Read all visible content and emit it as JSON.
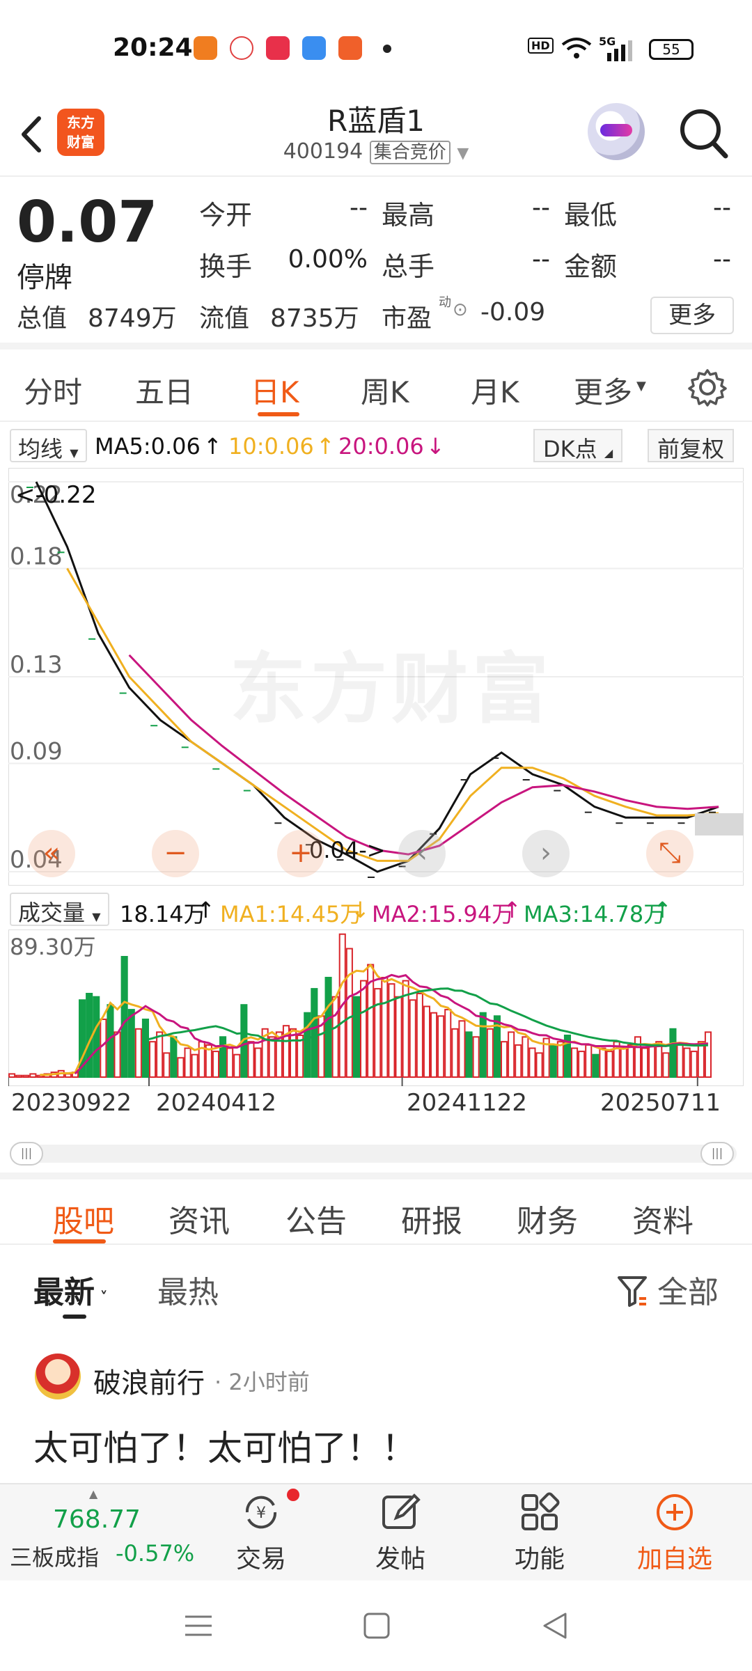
{
  "status": {
    "time": "20:24",
    "battery": "55",
    "network": "5G",
    "hd": "HD"
  },
  "header": {
    "logo_text": "东方财富",
    "title": "R蓝盾1",
    "code": "400194",
    "tag": "集合竞价"
  },
  "quote": {
    "price": "0.07",
    "status": "停牌",
    "fields": [
      {
        "label": "今开",
        "value": "--"
      },
      {
        "label": "最高",
        "value": "--"
      },
      {
        "label": "最低",
        "value": "--"
      },
      {
        "label": "换手",
        "value": "0.00%"
      },
      {
        "label": "总手",
        "value": "--"
      },
      {
        "label": "金额",
        "value": "--"
      }
    ],
    "total_value_label": "总值",
    "total_value": "8749万",
    "float_value_label": "流值",
    "float_value": "8735万",
    "pe_label": "市盈",
    "pe_sup": "动",
    "pe_value": "-0.09",
    "more": "更多"
  },
  "ktabs": [
    "分时",
    "五日",
    "日K",
    "周K",
    "月K",
    "更多"
  ],
  "ma_legend": {
    "select": "均线",
    "ma5": "MA5:0.06",
    "ma10": "10:0.06",
    "ma20": "20:0.06",
    "dk": "DK点",
    "adj": "前复权",
    "colors": {
      "ma5": "#111111",
      "ma10": "#f0b020",
      "ma20": "#c8157e"
    }
  },
  "chart_data": [
    {
      "type": "line",
      "title": "",
      "y_ticks": [
        "0.22",
        "0.18",
        "0.13",
        "0.09",
        "0.04"
      ],
      "ylim": [
        0.04,
        0.22
      ],
      "annotations": [
        "<-0.22",
        "0.04->"
      ],
      "series": [
        {
          "name": "MA5",
          "color": "#111111",
          "values": [
            0.22,
            0.19,
            0.15,
            0.125,
            0.11,
            0.1,
            0.09,
            0.08,
            0.065,
            0.055,
            0.048,
            0.04,
            0.045,
            0.06,
            0.085,
            0.095,
            0.085,
            0.08,
            0.07,
            0.065,
            0.065,
            0.065,
            0.07
          ]
        },
        {
          "name": "MA10",
          "color": "#f0b020",
          "values": [
            null,
            0.18,
            0.155,
            0.13,
            0.115,
            0.1,
            0.09,
            0.08,
            0.07,
            0.06,
            0.05,
            0.045,
            0.045,
            0.055,
            0.075,
            0.088,
            0.088,
            0.083,
            0.075,
            0.07,
            0.066,
            0.066,
            0.067
          ]
        },
        {
          "name": "MA20",
          "color": "#c8157e",
          "values": [
            null,
            null,
            null,
            0.14,
            0.125,
            0.11,
            0.098,
            0.087,
            0.076,
            0.066,
            0.056,
            0.05,
            0.048,
            0.052,
            0.062,
            0.072,
            0.079,
            0.08,
            0.077,
            0.073,
            0.07,
            0.069,
            0.07
          ]
        }
      ]
    },
    {
      "type": "bar",
      "title": "",
      "max_label": "89.30万",
      "ylim": [
        0,
        89.3
      ],
      "x_labels": [
        "20230922",
        "20240412",
        "20241122",
        "20250711"
      ],
      "values": [
        2,
        1,
        1,
        2,
        1,
        2,
        3,
        4,
        2,
        3,
        48,
        52,
        50,
        36,
        45,
        28,
        75,
        42,
        30,
        36,
        22,
        28,
        15,
        25,
        12,
        18,
        14,
        22,
        20,
        16,
        25,
        18,
        14,
        45,
        22,
        18,
        30,
        25,
        28,
        32,
        30,
        26,
        40,
        55,
        38,
        62,
        50,
        89,
        80,
        50,
        60,
        70,
        55,
        62,
        58,
        50,
        60,
        48,
        52,
        44,
        40,
        38,
        42,
        30,
        35,
        28,
        25,
        40,
        30,
        38,
        22,
        28,
        20,
        25,
        18,
        15,
        24,
        20,
        22,
        26,
        18,
        16,
        20,
        14,
        18,
        16,
        22,
        18,
        20,
        25,
        18,
        20,
        22,
        15,
        30,
        20,
        18,
        16,
        22,
        28
      ],
      "colors": [
        "r",
        "r",
        "r",
        "r",
        "r",
        "r",
        "r",
        "r",
        "r",
        "r",
        "g",
        "g",
        "g",
        "r",
        "g",
        "r",
        "g",
        "g",
        "r",
        "g",
        "r",
        "r",
        "r",
        "g",
        "r",
        "r",
        "r",
        "r",
        "r",
        "r",
        "g",
        "r",
        "r",
        "g",
        "r",
        "r",
        "r",
        "r",
        "r",
        "r",
        "r",
        "r",
        "g",
        "g",
        "r",
        "g",
        "r",
        "r",
        "r",
        "g",
        "r",
        "r",
        "r",
        "r",
        "r",
        "r",
        "r",
        "r",
        "r",
        "r",
        "r",
        "r",
        "r",
        "r",
        "r",
        "g",
        "r",
        "g",
        "r",
        "g",
        "r",
        "r",
        "r",
        "r",
        "r",
        "r",
        "r",
        "g",
        "r",
        "g",
        "r",
        "r",
        "r",
        "g",
        "r",
        "r",
        "r",
        "r",
        "r",
        "r",
        "r",
        "r",
        "r",
        "r",
        "g",
        "r",
        "r",
        "r",
        "r",
        "r"
      ],
      "series": [
        {
          "name": "MA1",
          "color": "#f0b020"
        },
        {
          "name": "MA2",
          "color": "#c8157e"
        },
        {
          "name": "MA3",
          "color": "#12a049"
        }
      ]
    }
  ],
  "vol_legend": {
    "select": "成交量",
    "vol": "18.14万",
    "ma1": "MA1:14.45万",
    "ma2": "MA2:15.94万",
    "ma3": "MA3:14.78万"
  },
  "x_axis_dates": [
    "20230922",
    "20240412",
    "20241122",
    "20250711"
  ],
  "watermark": "东方财富",
  "sub_tabs": [
    "股吧",
    "资讯",
    "公告",
    "研报",
    "财务",
    "资料"
  ],
  "feed": {
    "latest": "最新",
    "hot": "最热",
    "filter_all": "全部"
  },
  "post": {
    "user": "破浪前行",
    "time": "· 2小时前",
    "text": "太可怕了！太可怕了！！"
  },
  "bottom": {
    "index_value": "768.77",
    "index_name": "三板成指",
    "index_change": "-0.57%",
    "items": [
      "交易",
      "发帖",
      "功能",
      "加自选"
    ]
  }
}
